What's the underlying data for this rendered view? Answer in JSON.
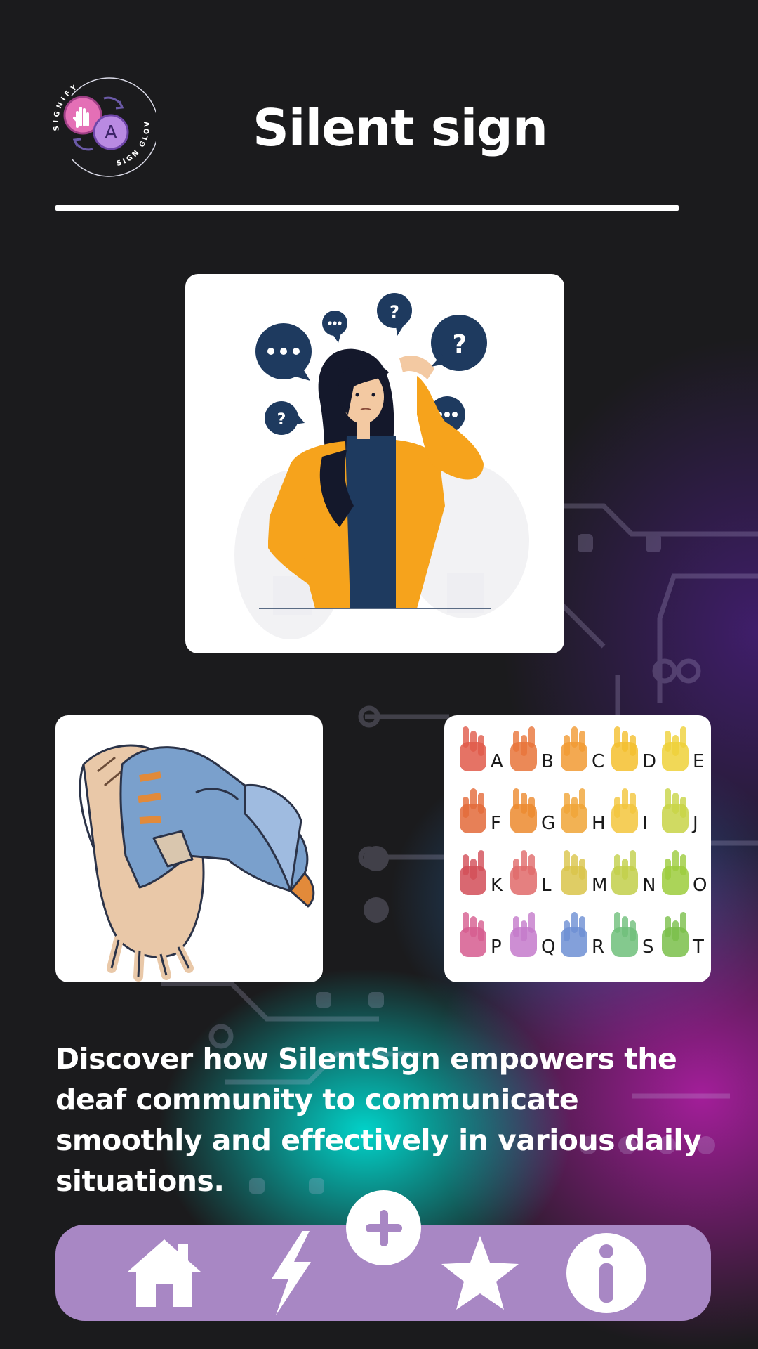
{
  "app": {
    "title": "Silent sign",
    "logo": {
      "arc_top_text": "SIGNIFY",
      "arc_bottom_text": "SIGN GLOVE",
      "badge_letter": "A"
    }
  },
  "main": {
    "hero_image": {
      "icon": "confused-woman-illustration"
    },
    "gloves_image": {
      "icon": "gloves-illustration"
    },
    "alphabet_image": {
      "icon": "sign-language-alphabet-chart",
      "letters": [
        "A",
        "B",
        "C",
        "D",
        "E",
        "F",
        "G",
        "H",
        "I",
        "J",
        "K",
        "L",
        "M",
        "N",
        "O",
        "P",
        "Q",
        "R",
        "S",
        "T"
      ]
    },
    "description": "Discover how SilentSign empowers the deaf community to communicate smoothly and effectively in various daily situations."
  },
  "nav": {
    "items": [
      {
        "icon": "home-icon"
      },
      {
        "icon": "lightning-icon"
      },
      {
        "icon": "plus-icon"
      },
      {
        "icon": "star-icon"
      },
      {
        "icon": "info-icon"
      }
    ]
  },
  "colors": {
    "background": "#1b1b1d",
    "nav_bar": "#a887c4",
    "text": "#ffffff",
    "glow_teal": "#00dcd2",
    "glow_magenta": "#aa1ea0",
    "navy": "#1e3a5f",
    "cardigan": "#f6a31c"
  }
}
